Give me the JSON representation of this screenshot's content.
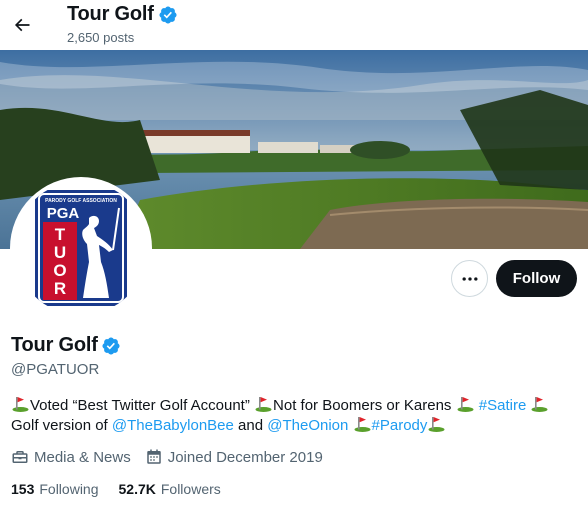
{
  "header": {
    "name": "Tour Golf",
    "posts": "2,650 posts"
  },
  "profile": {
    "display_name": "Tour Golf",
    "handle": "@PGATUOR",
    "follow_label": "Follow",
    "avatar": {
      "top_text": "PARODY GOLF ASSOCIATION",
      "pga": "PGA",
      "letters": [
        "T",
        "U",
        "O",
        "R"
      ]
    },
    "bio": {
      "seg1": "Voted “Best Twitter Golf Account”",
      "seg2": "Not for Boomers or Karens",
      "hashtag1": "#Satire",
      "seg3": "Golf version of",
      "mention1": "@TheBabylonBee",
      "and": "and",
      "mention2": "@TheOnion",
      "hashtag2": "#Parody"
    },
    "category": "Media & News",
    "joined": "Joined December 2019",
    "following_count": "153",
    "following_label": "Following",
    "followers_count": "52.7K",
    "followers_label": "Followers"
  },
  "colors": {
    "verified": "#1d9bf0",
    "link": "#1d9bf0",
    "follow_bg": "#0f1419",
    "secondary_text": "#536471",
    "logo_blue": "#1a3a8c",
    "logo_red": "#c8102e"
  },
  "icons": [
    "back-arrow-icon",
    "verified-badge-icon",
    "more-icon",
    "briefcase-icon",
    "calendar-icon",
    "golf-flag-icon"
  ]
}
